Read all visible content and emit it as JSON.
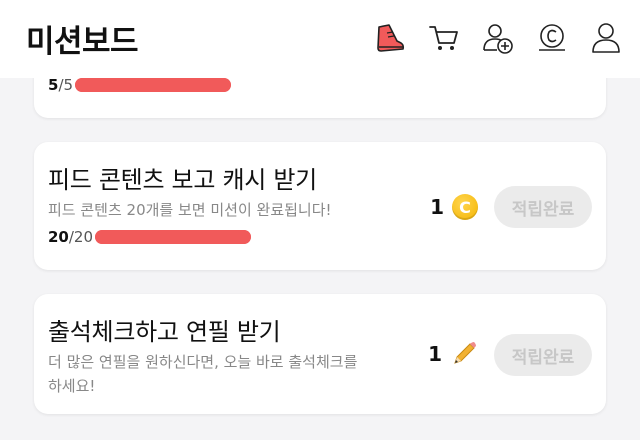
{
  "header": {
    "title": "미션보드",
    "icons": [
      "shoe-icon",
      "cart-icon",
      "add-friend-icon",
      "cash-coin-icon",
      "profile-icon"
    ]
  },
  "missions": [
    {
      "progress_current": "5",
      "progress_total": "/5",
      "progress_ratio": 1.0
    },
    {
      "title": "피드 콘텐츠 보고 캐시 받기",
      "description": "피드 콘텐츠 20개를 보면 미션이 완료됩니다!",
      "progress_current": "20",
      "progress_total": "/20",
      "progress_ratio": 1.0,
      "reward_count": "1",
      "reward_icon": "cash-coin-icon",
      "reward_coin_letter": "C",
      "button_label": "적립완료"
    },
    {
      "title": "출석체크하고 연필 받기",
      "description_line1": "더 많은 연필을 원하신다면, 오늘 바로 출석체크를",
      "description_line2": "하세요!",
      "reward_count": "1",
      "reward_icon": "pencil-icon",
      "button_label": "적립완료"
    }
  ],
  "colors": {
    "accent": "#f15a5a",
    "coin": "#f4b400",
    "button_bg": "#ebebeb",
    "button_text": "#c7c7c7",
    "pencil": "#f2b233"
  }
}
